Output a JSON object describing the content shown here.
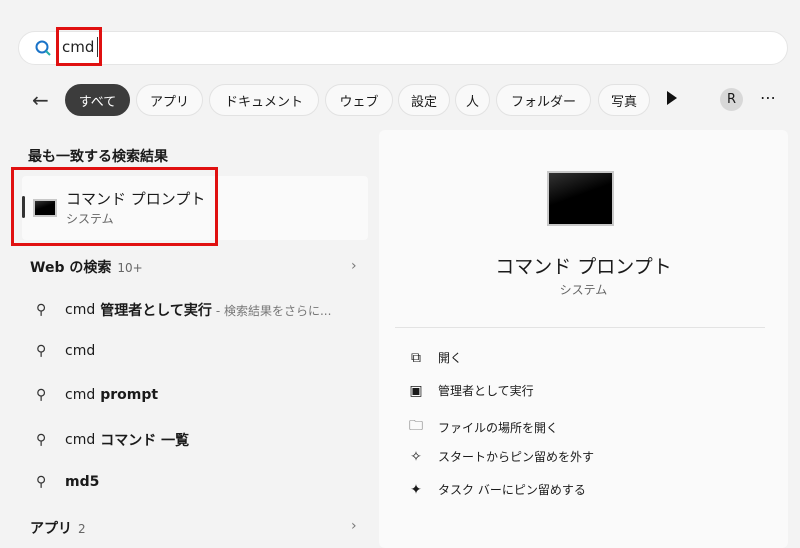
{
  "search": {
    "query": "cmd"
  },
  "filters": [
    "すべて",
    "アプリ",
    "ドキュメント",
    "ウェブ",
    "設定",
    "人",
    "フォルダー",
    "写真"
  ],
  "avatar_initial": "R",
  "best_match": {
    "heading": "最も一致する検索結果",
    "title": "コマンド プロンプト",
    "subtitle": "システム"
  },
  "web": {
    "heading": "Web の検索",
    "count": "10+",
    "items": [
      {
        "prefix": "cmd",
        "bold": "管理者として実行",
        "hint": "- 検索結果をさらに..."
      },
      {
        "prefix": "cmd",
        "bold": "",
        "hint": ""
      },
      {
        "prefix": "cmd",
        "bold": "prompt",
        "hint": ""
      },
      {
        "prefix": "cmd",
        "bold": "コマンド 一覧",
        "hint": ""
      },
      {
        "prefix": "",
        "bold": "md5",
        "hint": ""
      }
    ]
  },
  "apps": {
    "heading": "アプリ",
    "count": "2"
  },
  "detail": {
    "title": "コマンド プロンプト",
    "subtitle": "システム",
    "actions": [
      "開く",
      "管理者として実行",
      "ファイルの場所を開く",
      "スタートからピン留めを外す",
      "タスク バーにピン留めする"
    ]
  }
}
